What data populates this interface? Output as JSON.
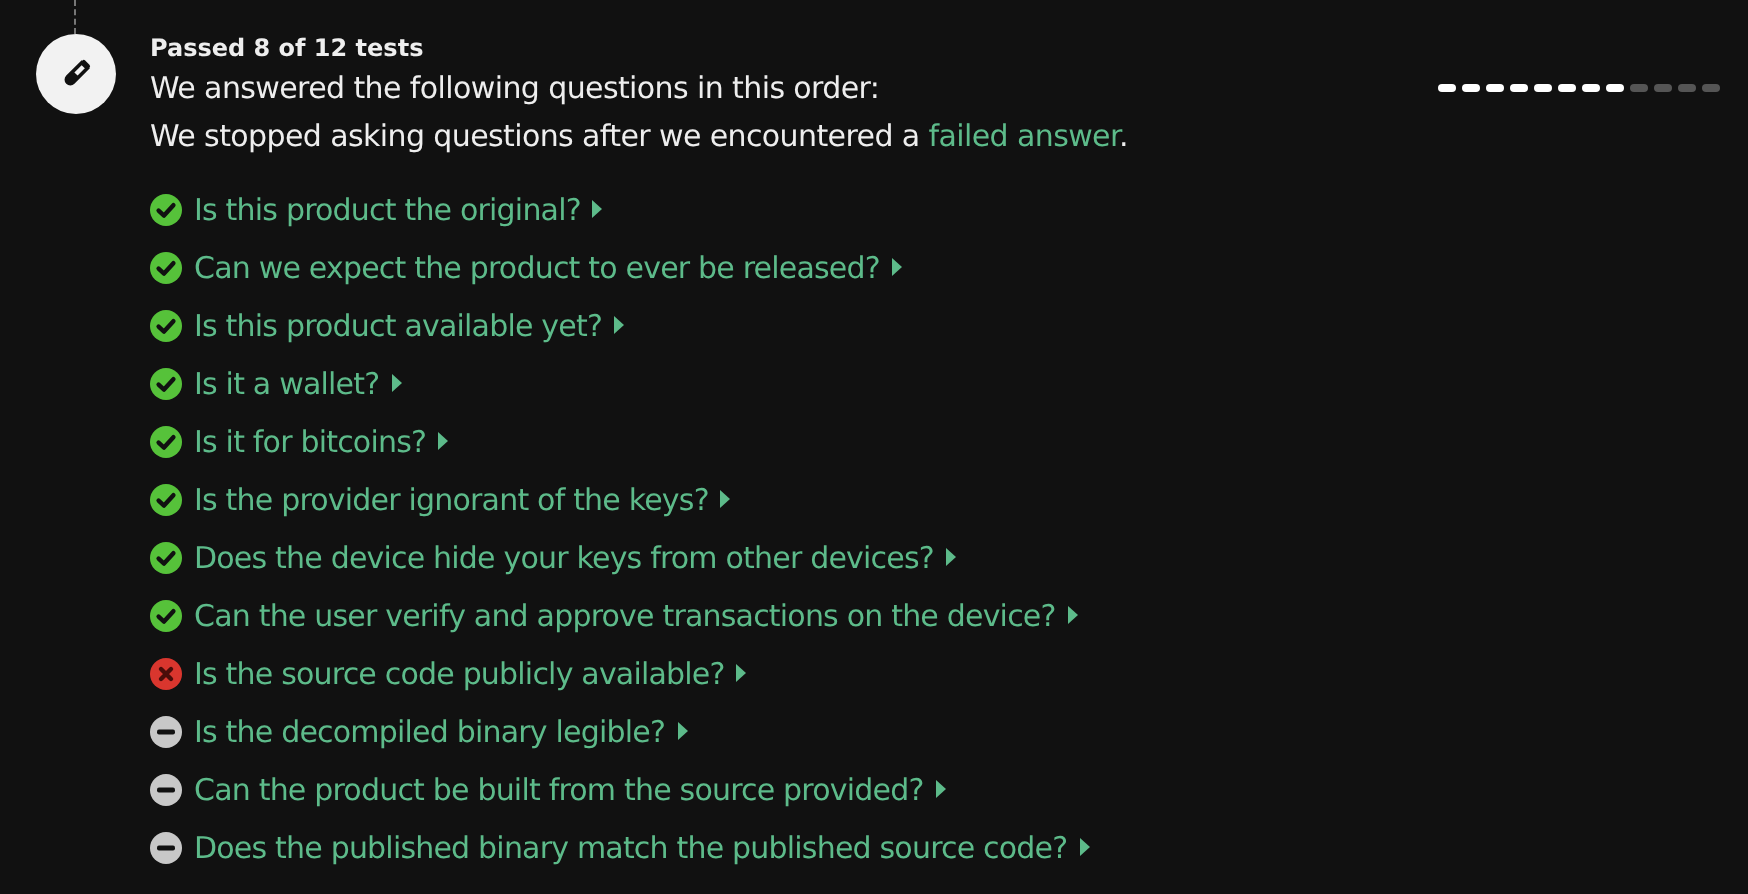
{
  "summary": "Passed 8 of 12 tests",
  "intro": "We answered the following questions in this order:",
  "stop_note": {
    "before": "We stopped asking questions after we encountered a ",
    "link": "failed answer",
    "after": "."
  },
  "progress_segments": [
    {
      "filled": true
    },
    {
      "filled": true
    },
    {
      "filled": true
    },
    {
      "filled": true
    },
    {
      "filled": true
    },
    {
      "filled": true
    },
    {
      "filled": true
    },
    {
      "filled": true
    },
    {
      "filled": false
    },
    {
      "filled": false
    },
    {
      "filled": false
    },
    {
      "filled": false
    }
  ],
  "questions": [
    {
      "kind": "passed",
      "text": "Is this product the original?"
    },
    {
      "kind": "passed",
      "text": "Can we expect the product to ever be released?"
    },
    {
      "kind": "passed",
      "text": "Is this product available yet?"
    },
    {
      "kind": "passed",
      "text": "Is it a wallet?"
    },
    {
      "kind": "passed",
      "text": "Is it for bitcoins?"
    },
    {
      "kind": "passed",
      "text": "Is the provider ignorant of the keys?"
    },
    {
      "kind": "passed",
      "text": "Does the device hide your keys from other devices?"
    },
    {
      "kind": "passed",
      "text": "Can the user verify and approve transactions on the device?"
    },
    {
      "kind": "failed",
      "text": "Is the source code publicly available?"
    },
    {
      "kind": "skipped",
      "text": "Is the decompiled binary legible?"
    },
    {
      "kind": "skipped",
      "text": "Can the product be built from the source provided?"
    },
    {
      "kind": "skipped",
      "text": "Does the published binary match the published source code?"
    }
  ]
}
